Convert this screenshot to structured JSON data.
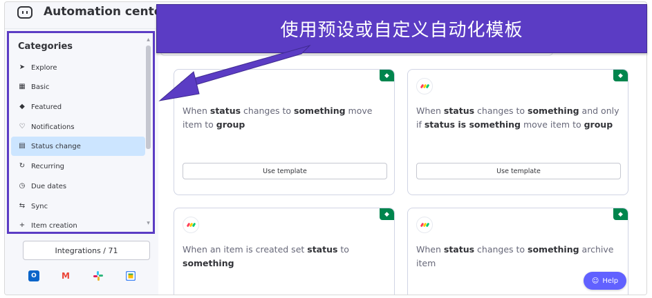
{
  "header": {
    "title": "Automation center",
    "app_icon": "automation-robot-icon"
  },
  "banner": {
    "text": "使用预设或自定义自动化模板",
    "color": "#5b3cc4"
  },
  "sidebar": {
    "heading": "Categories",
    "items": [
      {
        "label": "Explore",
        "icon": "rocket-icon"
      },
      {
        "label": "Basic",
        "icon": "blocks-icon"
      },
      {
        "label": "Featured",
        "icon": "diamond-icon"
      },
      {
        "label": "Notifications",
        "icon": "bell-icon"
      },
      {
        "label": "Status change",
        "icon": "status-list-icon",
        "active": true
      },
      {
        "label": "Recurring",
        "icon": "recurring-icon"
      },
      {
        "label": "Due dates",
        "icon": "alarm-clock-icon"
      },
      {
        "label": "Sync",
        "icon": "sync-icon"
      },
      {
        "label": "Item creation",
        "icon": "plus-icon"
      }
    ],
    "integrations_label": "Integrations / 71",
    "integration_logos": [
      "outlook-icon",
      "gmail-icon",
      "slack-icon",
      "google-calendar-icon"
    ]
  },
  "cards": [
    {
      "parts": [
        "When ",
        "status",
        " changes to ",
        "something",
        " move item to ",
        "group"
      ],
      "button": "Use template"
    },
    {
      "parts": [
        "When ",
        "status",
        " changes to ",
        "something",
        " and only if ",
        "status is something",
        " move item to ",
        "group"
      ],
      "button": "Use template"
    },
    {
      "parts": [
        "When an item is created set ",
        "status",
        " to ",
        "something"
      ]
    },
    {
      "parts": [
        "When ",
        "status",
        " changes to ",
        "something",
        " archive item"
      ]
    }
  ],
  "help": {
    "label": "Help"
  },
  "colors": {
    "accent": "#5b3cc4",
    "active_item": "#cce5ff",
    "badge": "#00854d",
    "help": "#6161ff"
  }
}
